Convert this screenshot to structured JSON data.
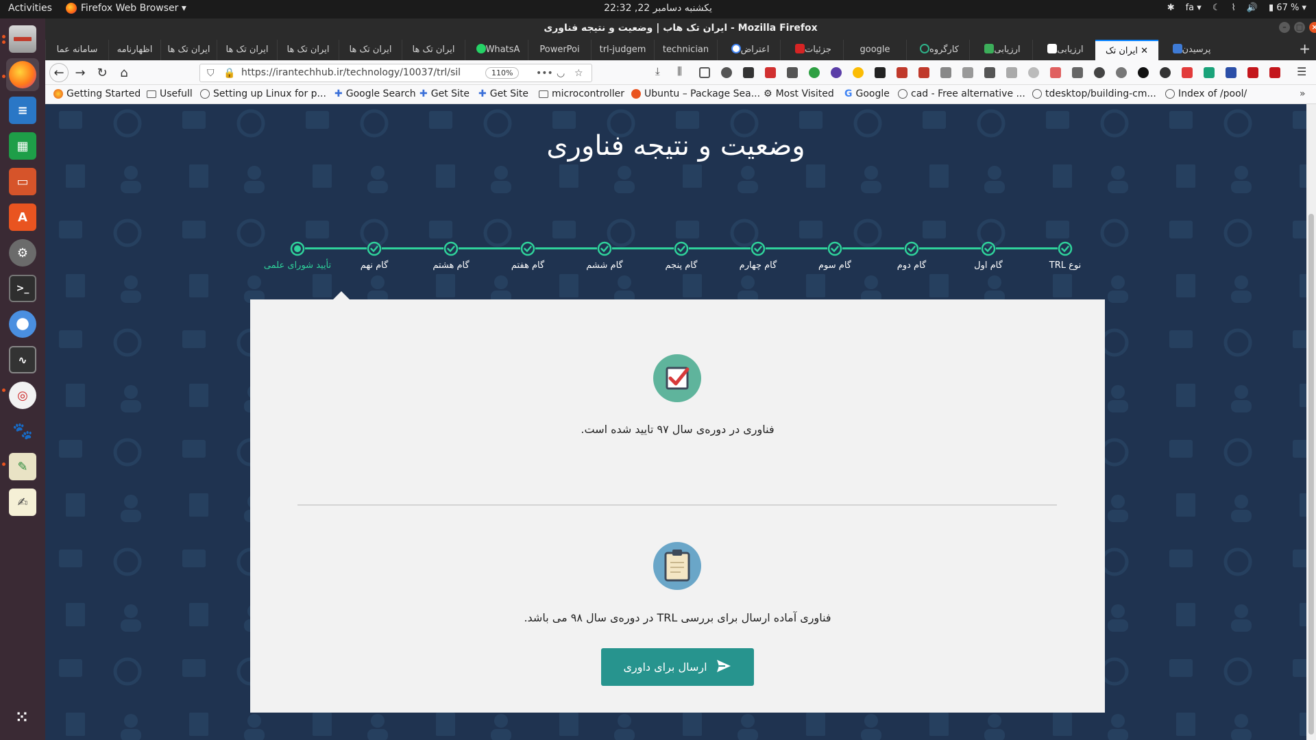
{
  "system_bar": {
    "activities": "Activities",
    "app_name": "Firefox Web Browser ▾",
    "clock": "یکشنبه دسامبر 22, 22:32",
    "lang": "fa ▾",
    "battery": "67 % ▾"
  },
  "window": {
    "title": "ایران تک هاب | وضعیت و نتیجه فناوری - Mozilla Firefox"
  },
  "tabs": [
    {
      "label": "سامانه عما"
    },
    {
      "label": "اظهارنامه"
    },
    {
      "label": "ایران تک ها"
    },
    {
      "label": "ایران تک ها"
    },
    {
      "label": "ایران تک ها"
    },
    {
      "label": "ایران تک ها"
    },
    {
      "label": "ایران تک ها"
    },
    {
      "label": "WhatsA"
    },
    {
      "label": "PowerPoi"
    },
    {
      "label": "trl-judgem"
    },
    {
      "label": "technician"
    },
    {
      "label": "اعتراض"
    },
    {
      "label": "جزئیات"
    },
    {
      "label": "google"
    },
    {
      "label": "کارگروه"
    },
    {
      "label": "ارزیابی"
    },
    {
      "label": "ارزیابی"
    },
    {
      "label": "ایران تک"
    },
    {
      "label": "پرسیدن"
    }
  ],
  "navbar": {
    "url": "https://irantechhub.ir/technology/10037/trl/sil",
    "zoom": "110%"
  },
  "bookmarks": [
    {
      "label": "Getting Started"
    },
    {
      "label": "Usefull"
    },
    {
      "label": "Setting up Linux for p..."
    },
    {
      "label": "Google Search"
    },
    {
      "label": "Get Site"
    },
    {
      "label": "Get Site"
    },
    {
      "label": "microcontroller"
    },
    {
      "label": "Ubuntu – Package Sea..."
    },
    {
      "label": "Most Visited"
    },
    {
      "label": "Google"
    },
    {
      "label": "cad - Free alternative ..."
    },
    {
      "label": "tdesktop/building-cm..."
    },
    {
      "label": "Index of /pool/"
    }
  ],
  "page": {
    "heading": "وضعیت و نتیجه فناوری",
    "steps": [
      {
        "label": "نوع TRL",
        "status": "done"
      },
      {
        "label": "گام اول",
        "status": "done"
      },
      {
        "label": "گام دوم",
        "status": "done"
      },
      {
        "label": "گام سوم",
        "status": "done"
      },
      {
        "label": "گام چهارم",
        "status": "done"
      },
      {
        "label": "گام پنجم",
        "status": "done"
      },
      {
        "label": "گام ششم",
        "status": "done"
      },
      {
        "label": "گام هفتم",
        "status": "done"
      },
      {
        "label": "گام هشتم",
        "status": "done"
      },
      {
        "label": "گام نهم",
        "status": "done"
      },
      {
        "label": "تأیید شورای علمی",
        "status": "current"
      }
    ],
    "approved_text": "فناوری در دوره‌ی سال ۹۷ تایید شده است.",
    "ready_text": "فناوری آماده ارسال برای بررسی TRL در دوره‌ی سال ۹۸ می باشد.",
    "submit_label": "ارسال برای داوری"
  },
  "colors": {
    "page_bg": "#1f3350",
    "step_accent": "#2fd39b",
    "button": "#27948e",
    "approved_icon_bg": "#5fb49c",
    "clipboard_icon_bg": "#6aa6c8"
  }
}
